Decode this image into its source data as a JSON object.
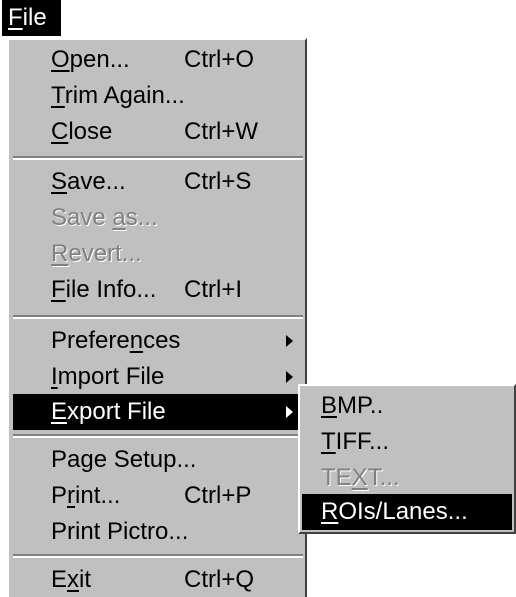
{
  "menubar": {
    "file": {
      "pre": "",
      "key": "F",
      "post": "ile"
    }
  },
  "file_menu": {
    "open": {
      "pre": "",
      "key": "O",
      "post": "pen...",
      "shortcut": "Ctrl+O"
    },
    "trim_again": {
      "pre": "",
      "key": "T",
      "post": "rim Again..."
    },
    "close": {
      "pre": "",
      "key": "C",
      "post": "lose",
      "shortcut": "Ctrl+W"
    },
    "save": {
      "pre": "",
      "key": "S",
      "post": "ave...",
      "shortcut": "Ctrl+S"
    },
    "save_as": {
      "pre": "Save ",
      "key": "a",
      "post": "s..."
    },
    "revert": {
      "pre": "",
      "key": "R",
      "post": "evert..."
    },
    "file_info": {
      "pre": "",
      "key": "F",
      "post": "ile Info...",
      "shortcut": "Ctrl+I"
    },
    "preferences": {
      "pre": "Prefere",
      "key": "n",
      "post": "ces"
    },
    "import_file": {
      "pre": "",
      "key": "I",
      "post": "mport File"
    },
    "export_file": {
      "pre": "",
      "key": "E",
      "post": "xport File"
    },
    "page_setup": {
      "pre": "Page Setup...",
      "key": "",
      "post": ""
    },
    "print": {
      "pre": "P",
      "key": "r",
      "post": "int...",
      "shortcut": "Ctrl+P"
    },
    "print_pictro": {
      "pre": "Print Pictro...",
      "key": "",
      "post": ""
    },
    "exit": {
      "pre": "E",
      "key": "x",
      "post": "it",
      "shortcut": "Ctrl+Q"
    }
  },
  "export_submenu": {
    "bmp": {
      "pre": "",
      "key": "B",
      "post": "MP.."
    },
    "tiff": {
      "pre": "",
      "key": "T",
      "post": "IFF..."
    },
    "text": {
      "pre": "TE",
      "key": "X",
      "post": "T..."
    },
    "rois_lanes": {
      "pre": "",
      "key": "R",
      "post": "OIs/Lanes..."
    }
  },
  "colors": {
    "menu_face": "#c0c0c0",
    "highlight": "#000000",
    "highlight_text": "#ffffff",
    "disabled_text": "#808080"
  },
  "icons": {
    "submenu_arrow": "submenu-arrow-icon"
  }
}
